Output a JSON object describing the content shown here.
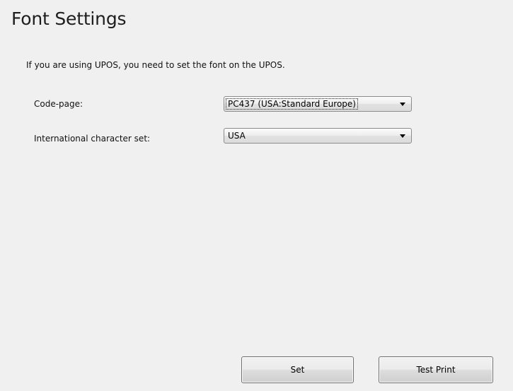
{
  "page": {
    "title": "Font Settings",
    "instruction": "If you are using UPOS, you need to set the font on the UPOS."
  },
  "fields": [
    {
      "label": "Code-page:",
      "value": "PC437 (USA:Standard Europe)",
      "icon": "chevron-down-icon"
    },
    {
      "label": "International character set:",
      "value": "USA",
      "icon": "chevron-down-icon"
    }
  ],
  "buttons": {
    "set_label": "Set",
    "test_print_label": "Test Print"
  },
  "colors": {
    "background": "#f0f0f0",
    "border": "#707070"
  }
}
